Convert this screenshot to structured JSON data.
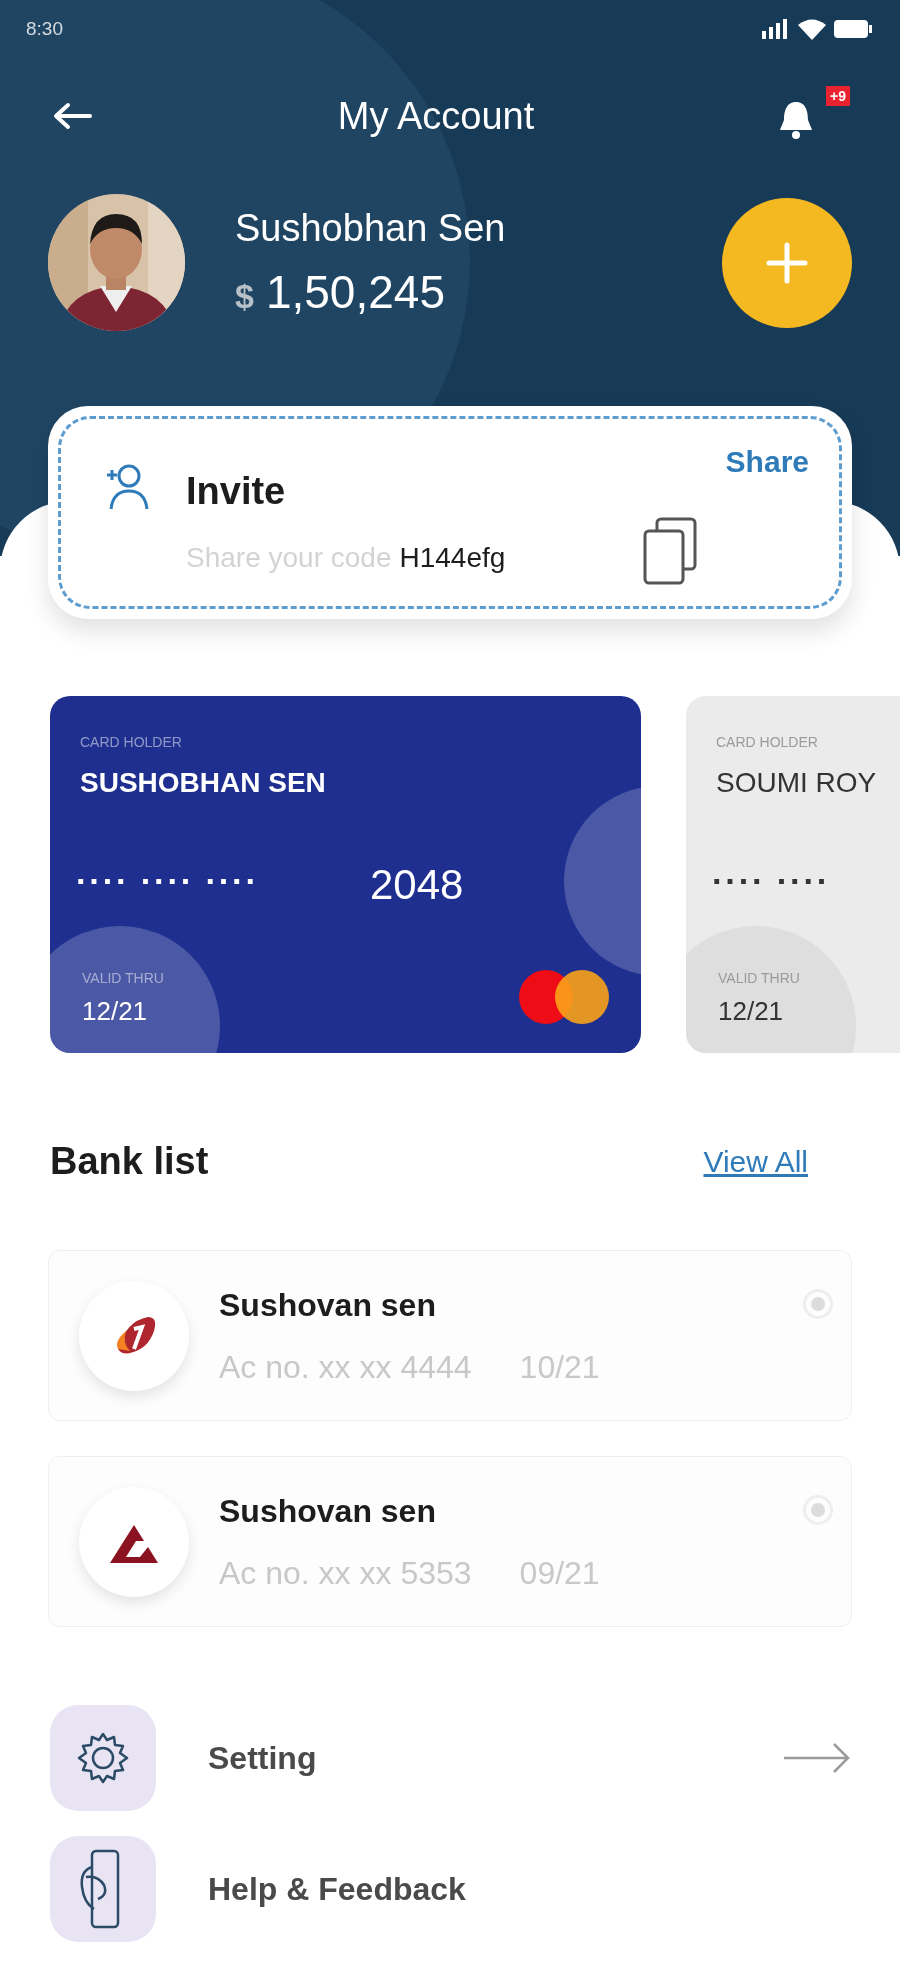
{
  "status_bar": {
    "time": "8:30"
  },
  "header": {
    "title": "My Account",
    "notification_badge": "+9"
  },
  "profile": {
    "name": "Sushobhan Sen",
    "currency": "$",
    "balance": "1,50,245"
  },
  "invite": {
    "title": "Invite",
    "share_label": "Share",
    "prompt": "Share your code",
    "code": "H144efg"
  },
  "cards": [
    {
      "kind": "blue",
      "holder_label": "CARD HOLDER",
      "holder": "SUSHOBHAN SEN",
      "masked": "···· ···· ····",
      "last4": "2048",
      "valid_label": "VALID THRU",
      "valid": "12/21"
    },
    {
      "kind": "grey",
      "holder_label": "CARD HOLDER",
      "holder": "SOUMI ROY",
      "masked": "···· ····",
      "valid_label": "VALID THRU",
      "valid": "12/21"
    }
  ],
  "bank_list": {
    "title": "Bank list",
    "view_all": "View All",
    "banks": [
      {
        "kind": "swoosh",
        "name": "Sushovan sen",
        "account": "Ac no. xx xx 4444",
        "expiry": "10/21",
        "selected": false
      },
      {
        "kind": "peak",
        "name": "Sushovan sen",
        "account": "Ac no. xx xx 5353",
        "expiry": "09/21",
        "selected": false
      }
    ]
  },
  "menu": [
    {
      "kind": "gear",
      "label": "Setting",
      "arrow": true
    },
    {
      "kind": "hand",
      "label": "Help & Feedback",
      "arrow": false
    }
  ]
}
